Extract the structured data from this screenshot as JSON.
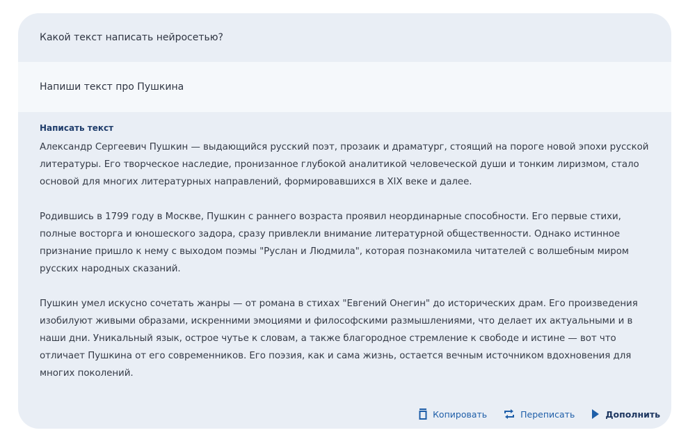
{
  "question": "Какой текст написать нейросетью?",
  "prompt": "Напиши текст про Пушкина",
  "result": {
    "title": "Написать текст",
    "paragraphs": [
      "Александр Сергеевич Пушкин — выдающийся русский поэт, прозаик и драматург, стоящий на пороге новой эпохи русской литературы. Его творческое наследие, пронизанное глубокой аналитикой человеческой души и тонким лиризмом, стало основой для многих литературных направлений, формировавшихся в XIX веке и далее.",
      "Родившись в 1799 году в Москве, Пушкин с раннего возраста проявил неординарные способности. Его первые стихи, полные восторга и юношеского задора, сразу привлекли внимание литературной общественности. Однако истинное признание пришло к нему с выходом поэмы \"Руслан и Людмила\", которая познакомила читателей с волшебным миром русских народных сказаний.",
      "Пушкин умел искусно сочетать жанры — от романа в стихах \"Евгений Онегин\" до исторических драм. Его произведения изобилуют живыми образами, искренними эмоциями и философскими размышлениями, что делает их актуальными и в наши дни. Уникальный язык, острое чутье к словам, а также благородное стремление к свободе и истине — вот что отличает Пушкина от его современников. Его поэзия, как и сама жизнь, остается вечным источником вдохновения для многих поколений."
    ]
  },
  "actions": {
    "copy": {
      "label": "Копировать",
      "icon": "copy-icon"
    },
    "rewrite": {
      "label": "Переписать",
      "icon": "repeat-icon"
    },
    "continue": {
      "label": "Дополнить",
      "icon": "play-icon"
    }
  },
  "colors": {
    "card_bg": "#e9eef5",
    "prompt_bg": "#f5f8fb",
    "accent": "#1e5ea8",
    "title": "#1f3d6b"
  }
}
